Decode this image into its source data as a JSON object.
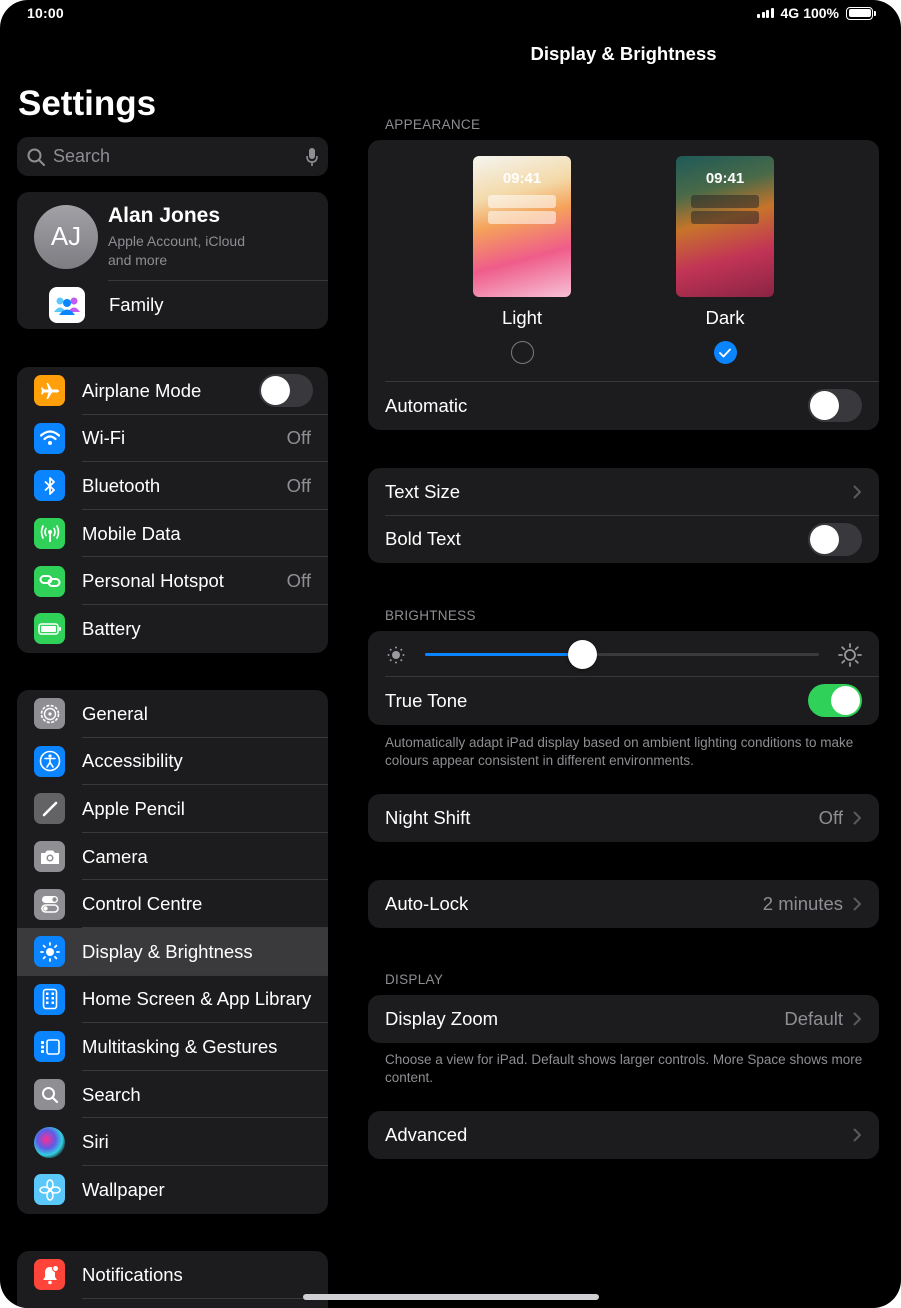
{
  "status_bar": {
    "time": "10:00",
    "network": "4G",
    "battery": "100%"
  },
  "sidebar": {
    "title": "Settings",
    "search_placeholder": "Search",
    "profile": {
      "initials": "AJ",
      "name": "Alan Jones",
      "subtitle": "Apple Account, iCloud and more"
    },
    "family_label": "Family",
    "connectivity": [
      {
        "label": "Airplane Mode",
        "icon": "airplane-icon",
        "color": "#ff9f0a",
        "toggle": false
      },
      {
        "label": "Wi-Fi",
        "icon": "wifi-icon",
        "color": "#0a84ff",
        "value": "Off"
      },
      {
        "label": "Bluetooth",
        "icon": "bluetooth-icon",
        "color": "#0a84ff",
        "value": "Off"
      },
      {
        "label": "Mobile Data",
        "icon": "antenna-icon",
        "color": "#30d158"
      },
      {
        "label": "Personal Hotspot",
        "icon": "hotspot-icon",
        "color": "#30d158",
        "value": "Off"
      },
      {
        "label": "Battery",
        "icon": "battery-icon",
        "color": "#30d158"
      }
    ],
    "system": [
      {
        "label": "General",
        "icon": "gear-icon",
        "color": "#8e8e93"
      },
      {
        "label": "Accessibility",
        "icon": "accessibility-icon",
        "color": "#0a84ff"
      },
      {
        "label": "Apple Pencil",
        "icon": "pencil-icon",
        "color": "#636366"
      },
      {
        "label": "Camera",
        "icon": "camera-icon",
        "color": "#8e8e93"
      },
      {
        "label": "Control Centre",
        "icon": "switches-icon",
        "color": "#8e8e93"
      },
      {
        "label": "Display & Brightness",
        "icon": "sun-icon",
        "color": "#0a84ff",
        "selected": true
      },
      {
        "label": "Home Screen & App Library",
        "icon": "home-screen-icon",
        "color": "#0a84ff"
      },
      {
        "label": "Multitasking & Gestures",
        "icon": "multitasking-icon",
        "color": "#0a84ff"
      },
      {
        "label": "Search",
        "icon": "search-icon",
        "color": "#8e8e93"
      },
      {
        "label": "Siri",
        "icon": "siri-icon",
        "color": "#000000"
      },
      {
        "label": "Wallpaper",
        "icon": "flower-icon",
        "color": "#5ac8fa"
      }
    ],
    "notifications": [
      {
        "label": "Notifications",
        "icon": "bell-icon",
        "color": "#ff453a"
      }
    ]
  },
  "detail": {
    "title": "Display & Brightness",
    "appearance_header": "APPEARANCE",
    "appearance": {
      "preview_time": "09:41",
      "light_label": "Light",
      "dark_label": "Dark",
      "selected": "Dark",
      "automatic_label": "Automatic",
      "automatic_on": false
    },
    "text_size_label": "Text Size",
    "bold_text_label": "Bold Text",
    "bold_text_on": false,
    "brightness_header": "BRIGHTNESS",
    "brightness_level": 0.4,
    "true_tone_label": "True Tone",
    "true_tone_on": true,
    "true_tone_footnote": "Automatically adapt iPad display based on ambient lighting conditions to make colours appear consistent in different environments.",
    "night_shift_label": "Night Shift",
    "night_shift_value": "Off",
    "auto_lock_label": "Auto-Lock",
    "auto_lock_value": "2 minutes",
    "display_header": "DISPLAY",
    "display_zoom_label": "Display Zoom",
    "display_zoom_value": "Default",
    "display_zoom_footnote": "Choose a view for iPad. Default shows larger controls. More Space shows more content.",
    "advanced_label": "Advanced"
  }
}
